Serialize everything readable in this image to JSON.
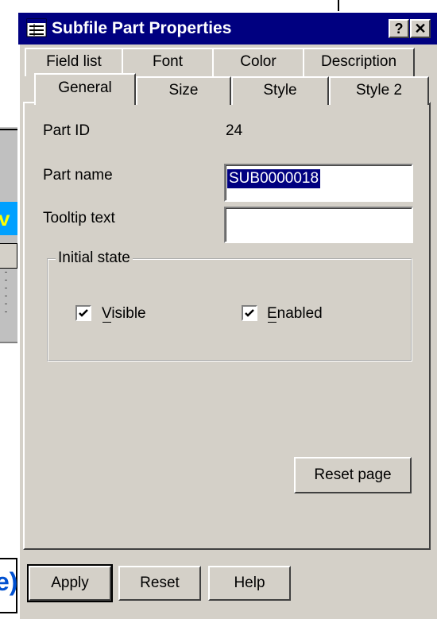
{
  "dialog": {
    "title": "Subfile Part Properties",
    "help_glyph": "?",
    "close_glyph": "✕"
  },
  "background": {
    "fragment_v": "v",
    "fragment_paren": "e)"
  },
  "tabs": {
    "row_back": [
      "Field list",
      "Font",
      "Color",
      "Description"
    ],
    "row_front": [
      "General",
      "Size",
      "Style",
      "Style 2"
    ],
    "active": "General"
  },
  "general": {
    "part_id_label": "Part ID",
    "part_id_value": "24",
    "part_name_label": "Part name",
    "part_name_value": "SUB0000018",
    "tooltip_label": "Tooltip text",
    "tooltip_value": "",
    "initial_state_title": "Initial state",
    "visible_label": "Visible",
    "visible_checked": true,
    "enabled_label": "Enabled",
    "enabled_checked": true,
    "reset_page_label": "Reset page"
  },
  "footer": {
    "apply_label": "Apply",
    "reset_label": "Reset",
    "help_label": "Help"
  }
}
